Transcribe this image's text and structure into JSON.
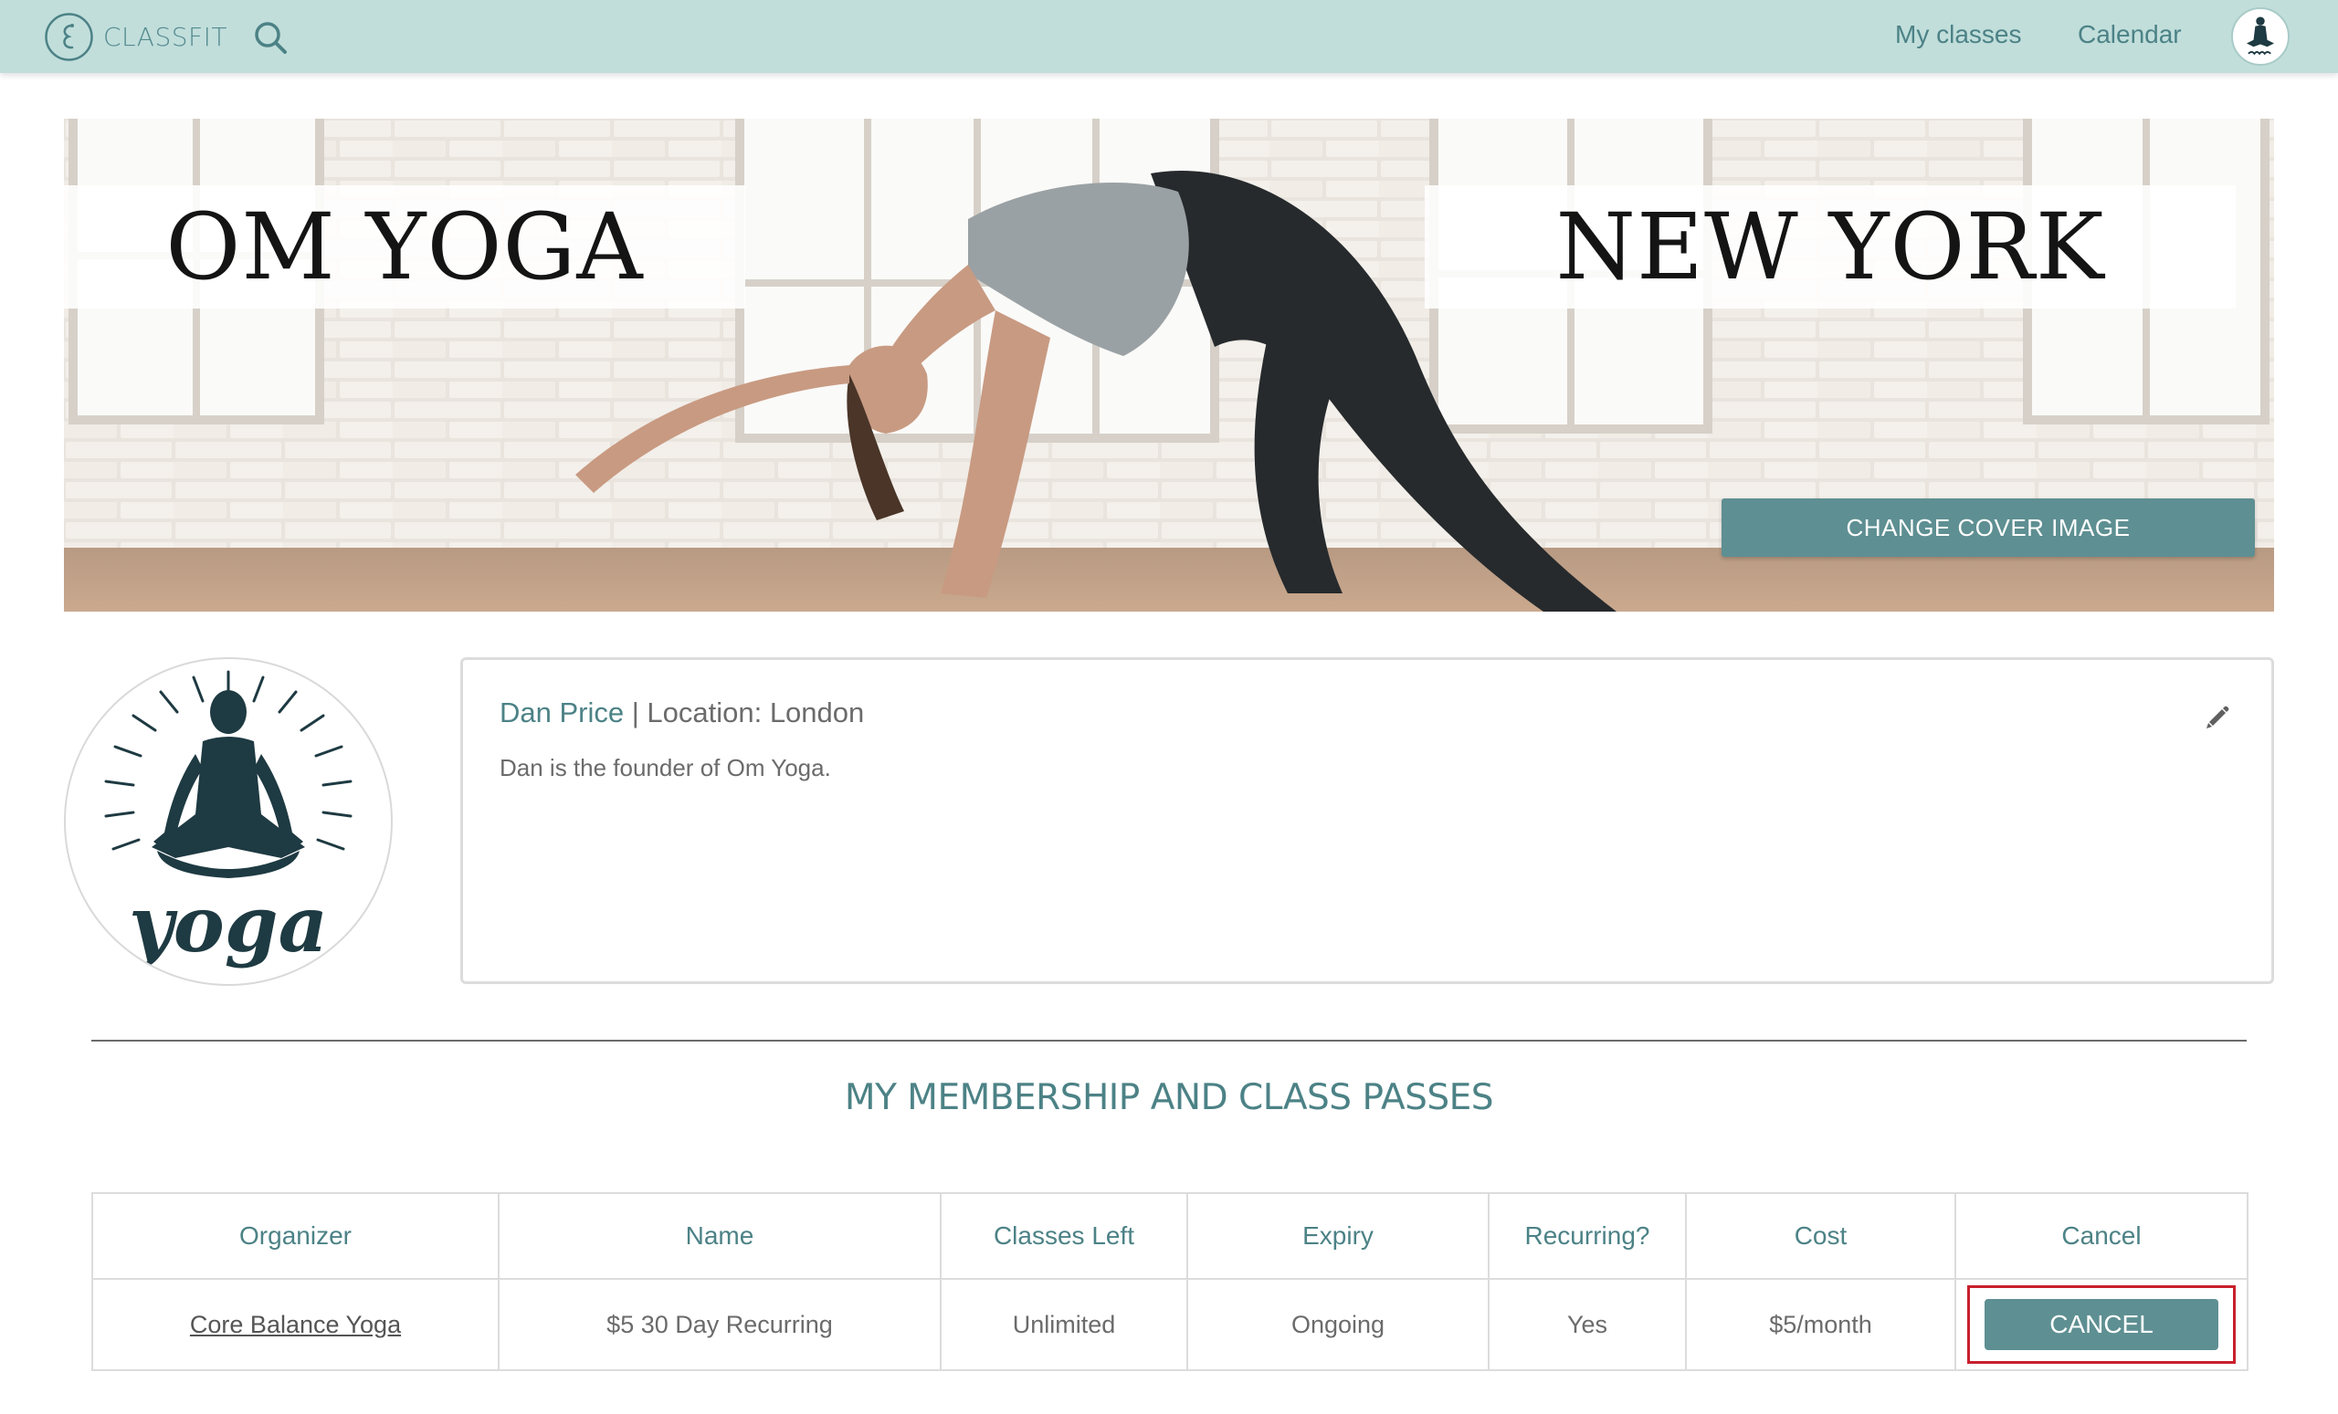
{
  "nav": {
    "brand": "CLASSFIT",
    "links": {
      "my_classes": "My classes",
      "calendar": "Calendar"
    },
    "icons": {
      "logo": "classfit-logo-icon",
      "search": "search-icon",
      "avatar": "yoga-avatar"
    }
  },
  "cover": {
    "title_left": "OM YOGA",
    "title_right": "NEW YORK",
    "change_button": "CHANGE COVER IMAGE"
  },
  "profile": {
    "name": "Dan Price",
    "separator": " | ",
    "location": "Location: London",
    "bio": "Dan is the founder of Om Yoga.",
    "avatar_caption": "yoga"
  },
  "section": {
    "title": "MY MEMBERSHIP AND CLASS PASSES"
  },
  "table": {
    "headers": [
      "Organizer",
      "Name",
      "Classes Left",
      "Expiry",
      "Recurring?",
      "Cost",
      "Cancel"
    ],
    "rows": [
      {
        "organizer": "Core Balance Yoga",
        "name": "$5 30 Day Recurring",
        "classes_left": "Unlimited",
        "expiry": "Ongoing",
        "recurring": "Yes",
        "cost": "$5/month",
        "cancel_label": "CANCEL"
      }
    ]
  },
  "colors": {
    "nav_bg": "#c1dedb",
    "accent": "#4c8286",
    "button": "#5e8f92",
    "highlight": "#c8202c"
  }
}
